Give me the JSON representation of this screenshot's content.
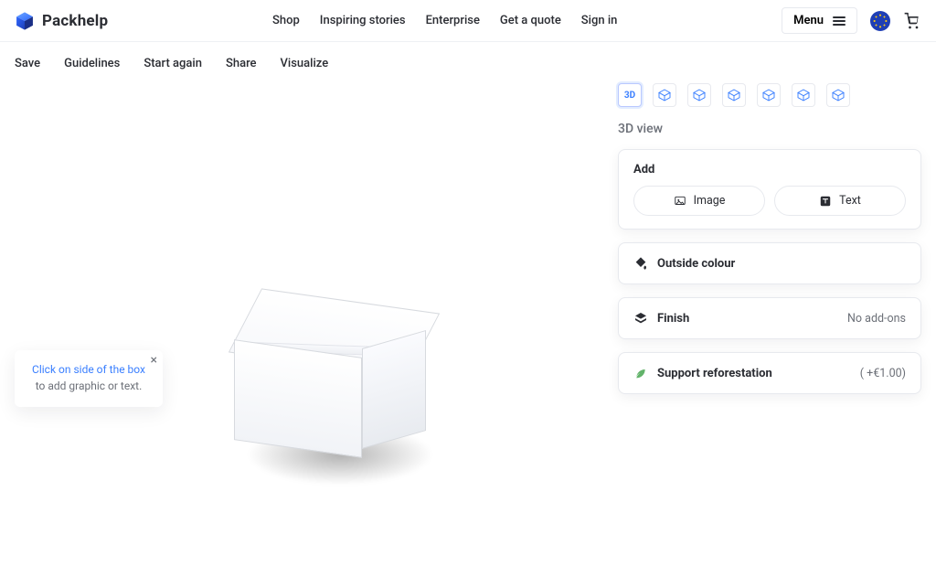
{
  "brand": {
    "name": "Packhelp"
  },
  "header": {
    "nav": {
      "shop": "Shop",
      "stories": "Inspiring stories",
      "enterprise": "Enterprise",
      "quote": "Get a quote",
      "signin": "Sign in"
    },
    "menu_label": "Menu"
  },
  "toolbar": {
    "save": "Save",
    "guidelines": "Guidelines",
    "start_again": "Start again",
    "share": "Share",
    "visualize": "Visualize"
  },
  "views": {
    "chip_3d": "3D",
    "section_title": "3D view"
  },
  "panels": {
    "add": {
      "title": "Add",
      "image": "Image",
      "text": "Text"
    },
    "outside_colour": {
      "title": "Outside colour"
    },
    "finish": {
      "title": "Finish",
      "value": "No add-ons"
    },
    "reforestation": {
      "title": "Support reforestation",
      "value": "( +€1.00)"
    }
  },
  "hint": {
    "lead": "Click on side of the box",
    "rest": " to add graphic or text."
  },
  "colors": {
    "accent": "#3a7fff"
  }
}
